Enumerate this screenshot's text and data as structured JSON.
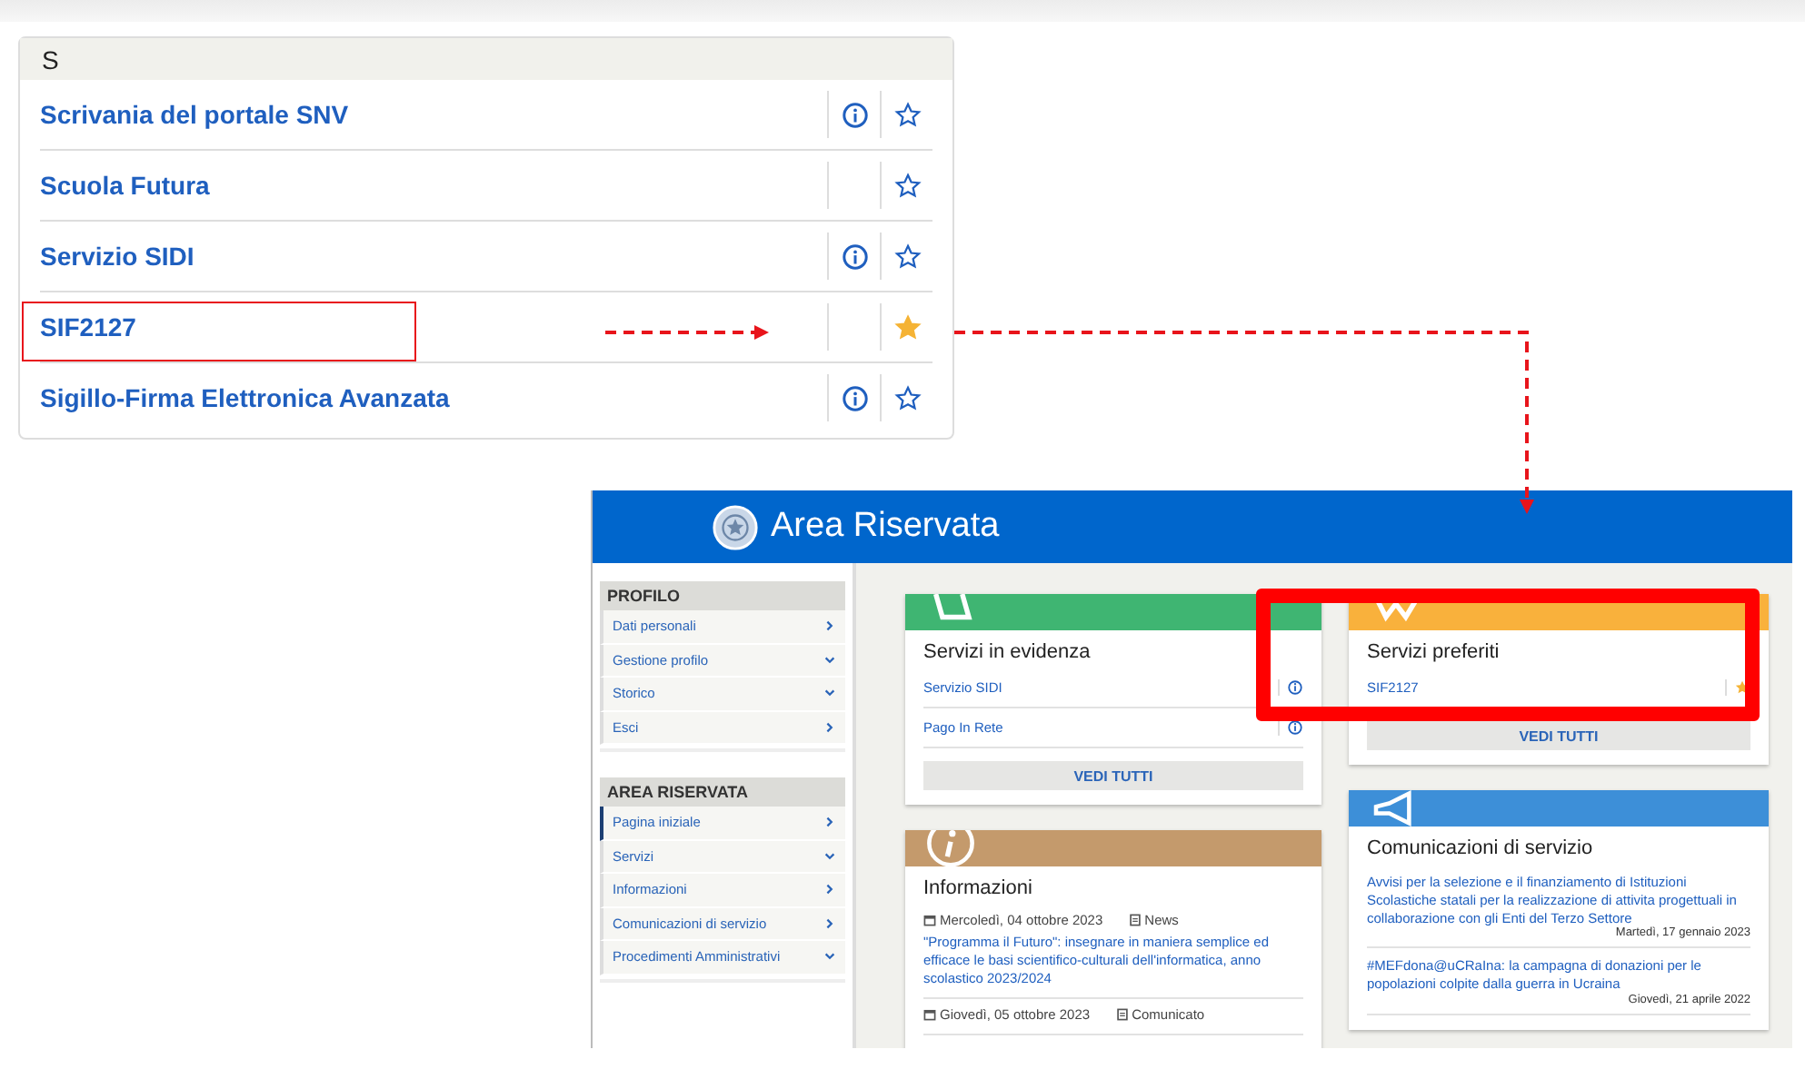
{
  "service_list": {
    "letter": "S",
    "items": [
      {
        "label": "Scrivania del portale SNV",
        "info": true,
        "favorite": false
      },
      {
        "label": "Scuola Futura",
        "info": false,
        "favorite": false
      },
      {
        "label": "Servizio SIDI",
        "info": true,
        "favorite": false
      },
      {
        "label": "SIF2127",
        "info": false,
        "favorite": true
      },
      {
        "label": "Sigillo-Firma Elettronica Avanzata",
        "info": true,
        "favorite": false
      }
    ]
  },
  "portal": {
    "title": "Area Riservata",
    "sidebar": [
      {
        "heading": "PROFILO",
        "items": [
          {
            "label": "Dati personali",
            "kind": "link",
            "selected": false
          },
          {
            "label": "Gestione profilo",
            "kind": "menu",
            "selected": false
          },
          {
            "label": "Storico",
            "kind": "menu",
            "selected": false
          },
          {
            "label": "Esci",
            "kind": "link",
            "selected": false
          }
        ]
      },
      {
        "heading": "AREA RISERVATA",
        "items": [
          {
            "label": "Pagina iniziale",
            "kind": "link",
            "selected": true
          },
          {
            "label": "Servizi",
            "kind": "menu",
            "selected": false
          },
          {
            "label": "Informazioni",
            "kind": "link",
            "selected": false
          },
          {
            "label": "Comunicazioni di servizio",
            "kind": "link",
            "selected": false
          },
          {
            "label": "Procedimenti Amministrativi",
            "kind": "menu",
            "selected": false
          }
        ]
      }
    ],
    "columns": [
      [
        {
          "kind": "featured",
          "color": "#3fb572",
          "title": "Servizi in evidenza",
          "items": [
            {
              "label": "Servizio SIDI",
              "kind": "info"
            },
            {
              "label": "Pago In Rete",
              "kind": "info"
            }
          ],
          "button": "VEDI TUTTI"
        },
        {
          "kind": "info",
          "color": "#c49a6c",
          "title": "Informazioni",
          "items": [
            {
              "date": "Mercoledì, 04 ottobre 2023",
              "category": "News",
              "text": "\"Programma il Futuro\": insegnare in maniera semplice ed efficace le basi scientifico-culturali dell'informatica, anno scolastico 2023/2024"
            },
            {
              "date": "Giovedì, 05 ottobre 2023",
              "category": "Comunicato"
            }
          ]
        }
      ],
      [
        {
          "kind": "favorites",
          "color": "#f9b13c",
          "title": "Servizi preferiti",
          "items": [
            {
              "label": "SIF2127",
              "kind": "favorite"
            }
          ],
          "button": "VEDI TUTTI"
        },
        {
          "kind": "news",
          "color": "#3d8fd8",
          "title": "Comunicazioni di servizio",
          "items": [
            {
              "text": "Avvisi per la selezione e il finanziamento di Istituzioni Scolastiche statali per la realizzazione di attivita progettuali in collaborazione con gli Enti del Terzo Settore",
              "date": "Martedì, 17 gennaio 2023"
            },
            {
              "text": "#MEFdona@uCRaIna: la campagna di donazioni per le popolazioni colpite dalla guerra in Ucraina",
              "date": "Giovedì, 21 aprile 2022"
            }
          ]
        }
      ]
    ]
  }
}
